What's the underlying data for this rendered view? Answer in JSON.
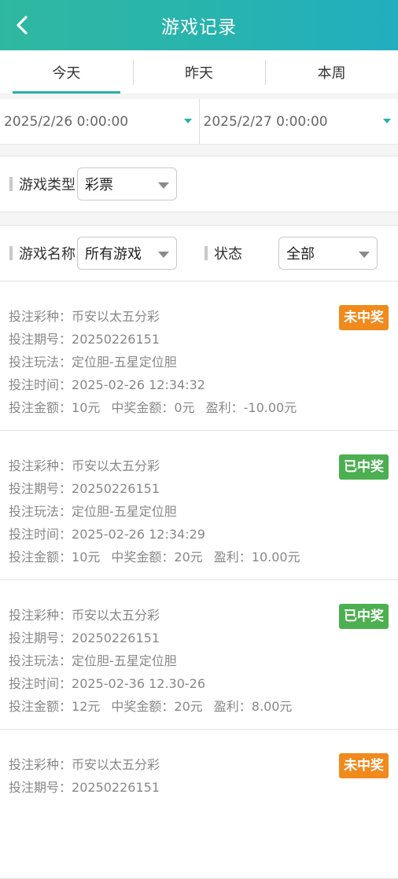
{
  "header": {
    "title": "游戏记录"
  },
  "tabs": [
    {
      "label": "今天",
      "active": true
    },
    {
      "label": "昨天",
      "active": false
    },
    {
      "label": "本周",
      "active": false
    }
  ],
  "date_range": {
    "start": "2025/2/26 0:00:00",
    "end": "2025/2/27 0:00:00"
  },
  "filters": {
    "game_type": {
      "label": "游戏类型",
      "value": "彩票"
    },
    "game_name": {
      "label": "游戏名称",
      "value": "所有游戏"
    },
    "status": {
      "label": "状态",
      "value": "全部"
    }
  },
  "field_labels": {
    "lottery": "投注彩种：",
    "issue": "投注期号：",
    "play": "投注玩法：",
    "time": "投注时间：",
    "amount": "投注金额：",
    "win_amount": "中奖金额：",
    "profit": "盈利："
  },
  "records": [
    {
      "lottery": "币安以太五分彩",
      "issue": "20250226151",
      "play": "定位胆-五星定位胆",
      "time": "2025-02-26 12:34:32",
      "amount": "10元",
      "win_amount": "0元",
      "profit": "-10.00元",
      "status": "未中奖",
      "status_color": "#f08a1c"
    },
    {
      "lottery": "币安以太五分彩",
      "issue": "20250226151",
      "play": "定位胆-五星定位胆",
      "time": "2025-02-26 12:34:29",
      "amount": "10元",
      "win_amount": "20元",
      "profit": "10.00元",
      "status": "已中奖",
      "status_color": "#4caf50"
    },
    {
      "lottery": "币安以太五分彩",
      "issue": "20250226151",
      "play": "定位胆-五星定位胆",
      "time": "2025-02-36 12.30-26",
      "amount": "12元",
      "win_amount": "20元",
      "profit": "8.00元",
      "status": "已中奖",
      "status_color": "#4caf50"
    },
    {
      "lottery": "币安以太五分彩",
      "issue": "20250226151",
      "play": "",
      "time": "",
      "amount": "",
      "win_amount": "",
      "profit": "",
      "status": "未中奖",
      "status_color": "#f08a1c"
    }
  ]
}
